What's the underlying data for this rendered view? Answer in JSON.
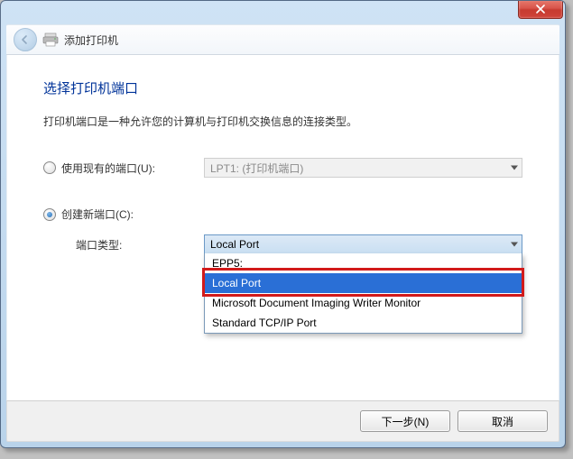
{
  "window": {
    "header_title": "添加打印机"
  },
  "page": {
    "heading": "选择打印机端口",
    "subtext": "打印机端口是一种允许您的计算机与打印机交换信息的连接类型。"
  },
  "options": {
    "use_existing_label": "使用现有的端口(U):",
    "existing_port_value": "LPT1: (打印机端口)",
    "create_new_label": "创建新端口(C):",
    "port_type_label": "端口类型:",
    "port_type_value": "Local Port",
    "port_type_items": {
      "0": "EPP5:",
      "1": "Local Port",
      "2": "Microsoft Document Imaging Writer Monitor",
      "3": "Standard TCP/IP Port"
    }
  },
  "footer": {
    "next": "下一步(N)",
    "cancel": "取消"
  }
}
